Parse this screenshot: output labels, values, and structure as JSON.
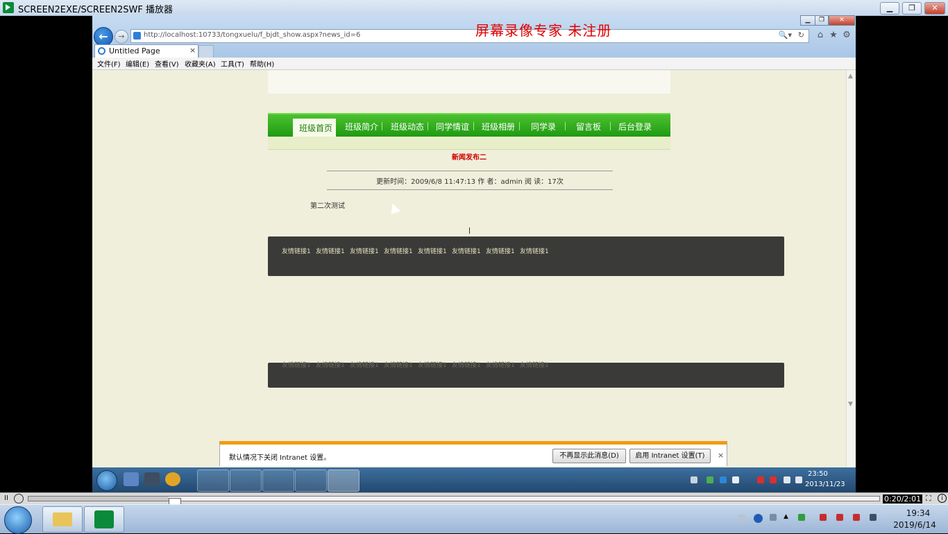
{
  "player": {
    "title": "SCREEN2EXE/SCREEN2SWF 播放器",
    "min_glyph": "▁",
    "max_glyph": "❐",
    "close_glyph": "✕",
    "pause_glyph": "II",
    "time_readout": "0:20/2:01",
    "fit_glyph": "⛶",
    "info_glyph": "i",
    "progress": 0.165
  },
  "watermark": "屏幕录像专家  未注册",
  "ie": {
    "address": "http://localhost:10733/tongxuelu/f_bjdt_show.aspx?news_id=6",
    "back_glyph": "←",
    "forward_glyph": "→",
    "search_glyph": "🔍▾",
    "refresh_glyph": "↻",
    "home_glyph": "⌂",
    "fav_glyph": "★",
    "tools_glyph": "⚙",
    "tab_title": "Untitled Page",
    "tab_close": "×",
    "menu": [
      "文件(F)",
      "编辑(E)",
      "查看(V)",
      "收藏夹(A)",
      "工具(T)",
      "帮助(H)"
    ]
  },
  "site": {
    "nav": [
      "班级首页",
      "班级简介",
      "班级动态",
      "同学情谊",
      "班级相册",
      "同学录",
      "留言板",
      "后台登录"
    ],
    "news_title": "新闻发布二",
    "meta": "更新时间：2009/6/8 11:47:13  作  者：admin  阅  读：17次",
    "body": "第二次测试",
    "links": [
      "友情链接1",
      "友情链接1",
      "友情链接1",
      "友情链接1",
      "友情链接1",
      "友情链接1",
      "友情链接1",
      "友情链接1"
    ]
  },
  "infobar": {
    "text": "默认情况下关闭 Intranet 设置。",
    "dont_show": "不再显示此消息(D)",
    "enable": "启用 Intranet 设置(T)",
    "close": "×"
  },
  "inner_clock": {
    "time": "23:50",
    "date": "2013/11/23"
  },
  "host_clock": {
    "time": "19:34",
    "date": "2019/6/14"
  }
}
